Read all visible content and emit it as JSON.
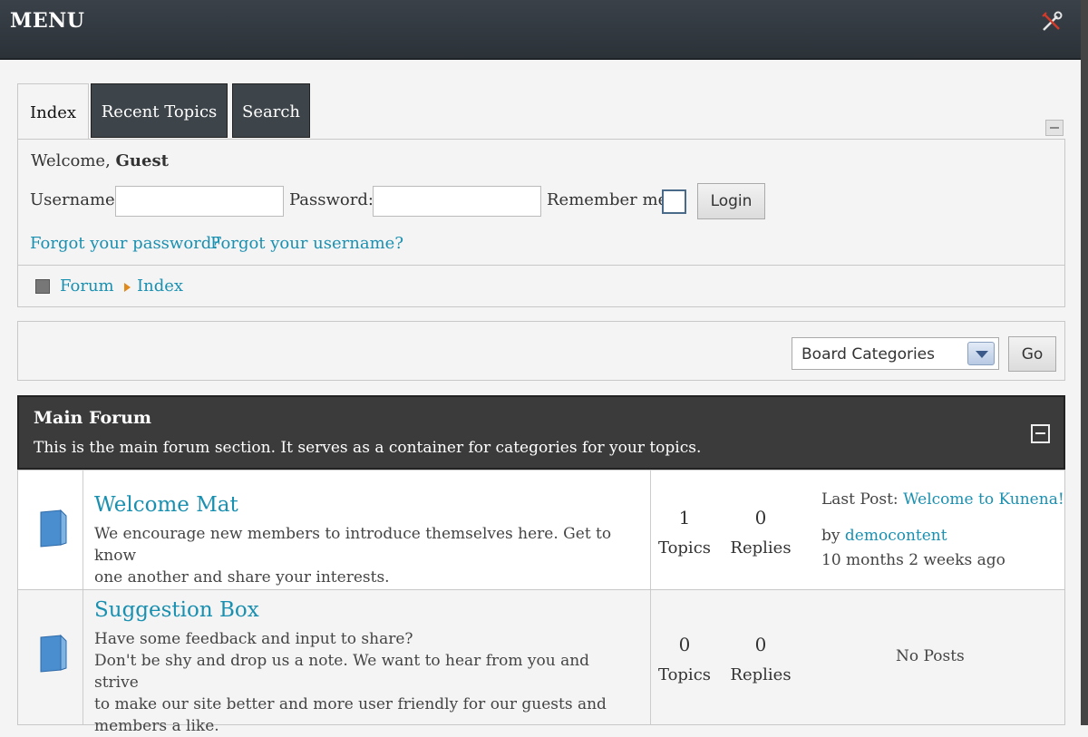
{
  "header": {
    "title": "MENU",
    "tools_icon": "tools-icon"
  },
  "tabs": [
    {
      "label": "Index",
      "active": true
    },
    {
      "label": "Recent Topics",
      "active": false
    },
    {
      "label": "Search",
      "active": false
    }
  ],
  "login": {
    "welcome_prefix": "Welcome,",
    "welcome_user": "Guest",
    "username_label": "Username:",
    "username_value": "",
    "password_label": "Password:",
    "password_value": "",
    "remember_label": "Remember me",
    "remember_checked": false,
    "login_button": "Login",
    "forgot_password": "Forgot your password?",
    "forgot_username": "Forgot your username?"
  },
  "breadcrumb": {
    "items": [
      "Forum",
      "Index"
    ]
  },
  "category_select": {
    "selected": "Board Categories",
    "go_button": "Go"
  },
  "main_forum": {
    "title": "Main Forum",
    "description": "This is the main forum section. It serves as a container for categories for your topics."
  },
  "forums": [
    {
      "name": "Welcome Mat",
      "description_lines": [
        "We encourage new members to introduce themselves here. Get to know",
        "one another and share your interests."
      ],
      "topics": "1",
      "topics_label": "Topics",
      "replies": "0",
      "replies_label": "Replies",
      "last_post_label": "Last Post:",
      "last_post_title": "Welcome to Kunena!",
      "by_label": "by",
      "last_post_author": "democontent",
      "last_post_time": "10 months 2 weeks ago"
    },
    {
      "name": "Suggestion Box",
      "description_lines": [
        "Have some feedback and input to share?",
        "Don't be shy and drop us a note. We want to hear from you and strive",
        "to make our site better and more user friendly for our guests and",
        "members a like."
      ],
      "topics": "0",
      "topics_label": "Topics",
      "replies": "0",
      "replies_label": "Replies",
      "no_posts": "No Posts"
    }
  ],
  "colors": {
    "link": "#1a90b0",
    "header_bg": "#2b3238",
    "forum_head_bg": "#3b3b3b",
    "breadcrumb_arrow": "#e08a1c"
  }
}
